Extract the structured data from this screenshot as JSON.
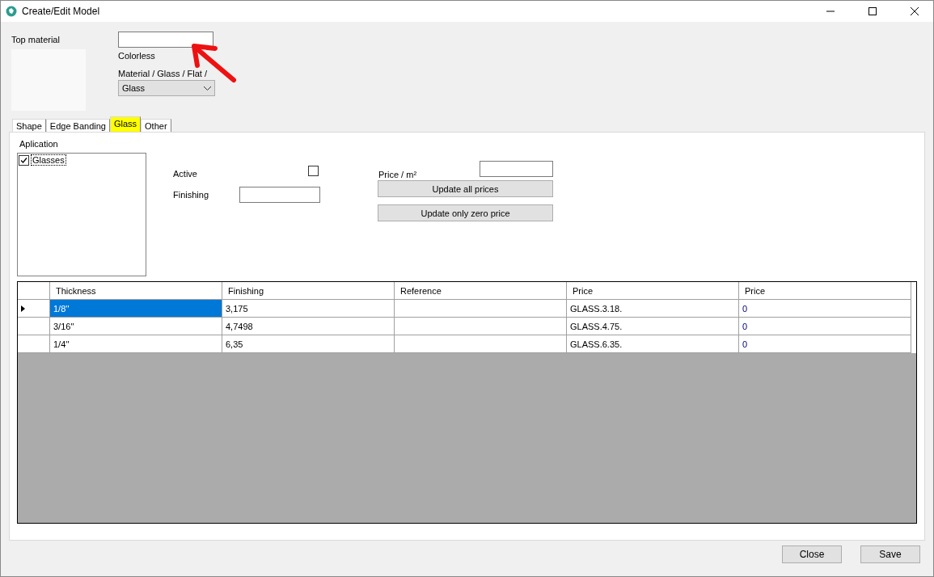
{
  "window": {
    "title": "Create/Edit Model"
  },
  "top": {
    "label": "Top material",
    "color_name": "Colorless",
    "path_label": "Material  / Glass / Flat /",
    "material": "Glass"
  },
  "tabs": [
    {
      "label": "Shape",
      "selected": false
    },
    {
      "label": "Edge Banding",
      "selected": false
    },
    {
      "label": "Glass",
      "selected": true
    },
    {
      "label": "Other",
      "selected": false
    }
  ],
  "application": {
    "label": "Aplication",
    "items": [
      {
        "label": "Glasses",
        "checked": true
      }
    ]
  },
  "active": {
    "label": "Active",
    "checked": false
  },
  "finishing": {
    "label": "Finishing"
  },
  "price": {
    "label": "Price / m²"
  },
  "buttons": [
    "Update all prices",
    "Update only zero price"
  ],
  "table": {
    "columns": [
      "Thickness",
      "Finishing",
      "Reference",
      "Price",
      "Price"
    ],
    "rows": [
      {
        "selected": true,
        "cells": [
          "1/8''",
          "3,175",
          "",
          "GLASS.3.18.",
          "0"
        ]
      },
      {
        "selected": false,
        "cells": [
          "3/16''",
          "4,7498",
          "",
          "GLASS.4.75.",
          "0"
        ]
      },
      {
        "selected": false,
        "cells": [
          "1/4''",
          "6,35",
          "",
          "GLASS.6.35.",
          "0"
        ]
      }
    ]
  },
  "footer_buttons": [
    "Close",
    "Save"
  ]
}
